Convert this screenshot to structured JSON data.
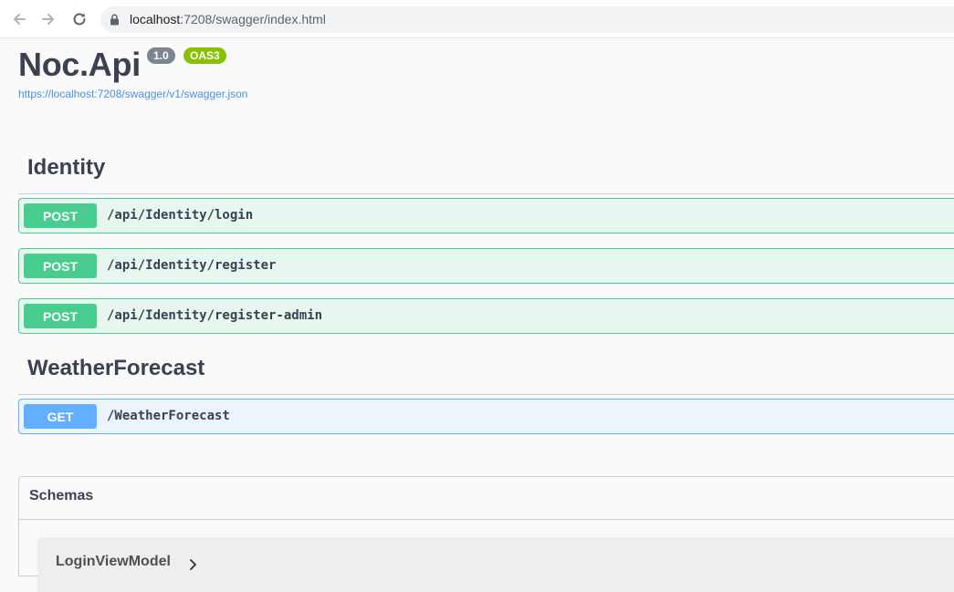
{
  "browser": {
    "url_host": "localhost",
    "url_rest": ":7208/swagger/index.html"
  },
  "info": {
    "title": "Noc.Api",
    "version": "1.0",
    "oas": "OAS3",
    "spec_url": "https://localhost:7208/swagger/v1/swagger.json"
  },
  "tags": [
    {
      "name": "Identity",
      "operations": [
        {
          "method": "POST",
          "path": "/api/Identity/login"
        },
        {
          "method": "POST",
          "path": "/api/Identity/register"
        },
        {
          "method": "POST",
          "path": "/api/Identity/register-admin"
        }
      ]
    },
    {
      "name": "WeatherForecast",
      "operations": [
        {
          "method": "GET",
          "path": "/WeatherForecast"
        }
      ]
    }
  ],
  "schemas": {
    "title": "Schemas",
    "models": [
      "LoginViewModel"
    ]
  },
  "colors": {
    "post": "#49cc90",
    "get": "#61affe",
    "oas_badge": "#89bf04",
    "version_badge": "#7d8492",
    "link": "#4990e2"
  },
  "icons": [
    "back-arrow-icon",
    "forward-arrow-icon",
    "reload-icon",
    "lock-icon",
    "chevron-right-icon"
  ]
}
